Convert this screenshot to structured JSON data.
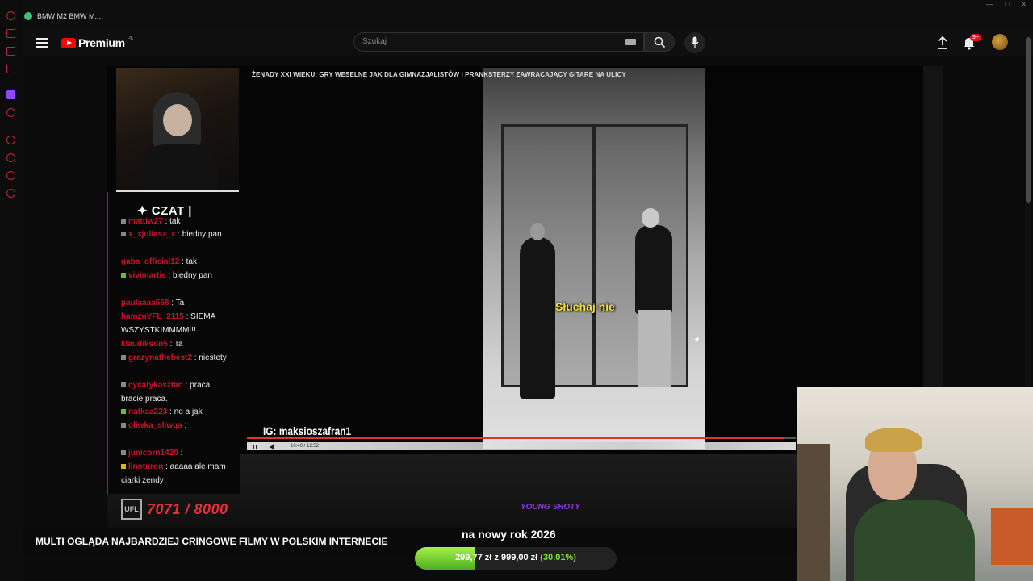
{
  "browser": {
    "tab_title": "BMW M2 BMW M...",
    "window_controls": [
      "—",
      "□",
      "✕"
    ]
  },
  "youtube": {
    "logo_text": "Premium",
    "logo_country": "PL",
    "search_placeholder": "Szukaj",
    "notification_badge": "9+"
  },
  "video": {
    "title": "ŻENADY XXI WIEKU: GRY WESELNE JAK DLA GIMNAZJALISTÓW I PRANKSTERZY ZAWRACAJĄCY GITARĘ NA ULICY",
    "subtitle": "Słuchaj nie",
    "ig_tag": "IG: maksioszafran1",
    "time": "10:40 / 12:52",
    "progress": 0.98
  },
  "chat": {
    "title": "✦ CZAT |",
    "messages": [
      {
        "user": "mattiw27",
        "text": "tak"
      },
      {
        "user": "x_xjuliasz_x",
        "text": "biedny pan"
      },
      {
        "user": "gaba_official12",
        "text": "tak"
      },
      {
        "user": "vivimartie",
        "text": "biedny pan"
      },
      {
        "user": "paulaaaa568",
        "text": "Ta"
      },
      {
        "user": "hamzuYFL_2115",
        "text": "SIEMA WSZYSTKIMMMM!!!"
      },
      {
        "user": "klaudikson5",
        "text": "Ta"
      },
      {
        "user": "grazynathebest2",
        "text": "niestety"
      },
      {
        "user": "cycatykasztan",
        "text": "praca bracie praca."
      },
      {
        "user": "natkaa223",
        "text": "no a jak"
      },
      {
        "user": "oliwka_sliwqa",
        "text": ""
      },
      {
        "user": "junicorn1420",
        "text": ""
      },
      {
        "user": "linoturon",
        "text": "aaaaa ale mam ciarki żendy"
      }
    ]
  },
  "overlay": {
    "goal_icon": "UFL",
    "goal_text": "7071 / 8000",
    "sponsor": "YOUNG SHOTY",
    "ticker": "MULTI OGLĄDA NAJBARDZIEJ CRINGOWE FILMY W POLSKIM INTERNECIE",
    "donation_title": "na nowy rok 2026",
    "donation_current": "299,77 zł",
    "donation_sep": "z",
    "donation_goal": "999,00 zł",
    "donation_pct": "(30.01%)",
    "donation_fraction": 0.3001
  },
  "colors": {
    "accent_red": "#c9122a",
    "youtube_red": "#ff0000",
    "donation_green": "#7fe03a",
    "subtitle_yellow": "#f6e33a"
  }
}
